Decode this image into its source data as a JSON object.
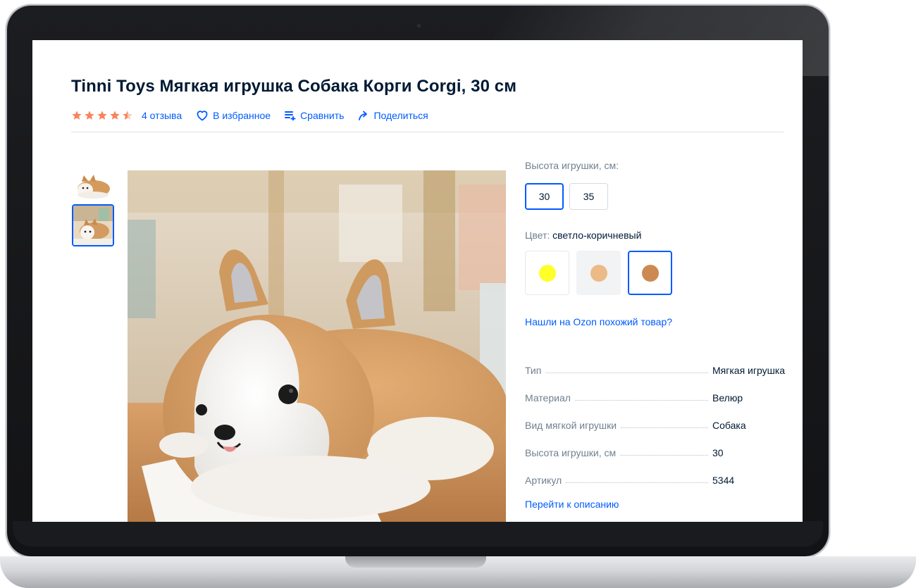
{
  "product": {
    "title": "Tinni Toys Мягкая игрушка Собака Корги Corgi, 30 см",
    "rating": 4.5,
    "reviews_label": "4 отзыва",
    "favorite_label": "В избранное",
    "compare_label": "Сравнить",
    "share_label": "Поделиться"
  },
  "gallery": {
    "thumbnails": [
      "corgi-side",
      "corgi-room"
    ],
    "selected_index": 1
  },
  "options": {
    "size_label": "Высота игрушки, см:",
    "sizes": [
      "30",
      "35"
    ],
    "selected_size": "30",
    "color_label": "Цвет:",
    "color_value": "светло-коричневый",
    "colors": [
      "#ffff2a",
      "#ecba86",
      "#cc8a52"
    ],
    "selected_color_index": 2
  },
  "similar_link": "Нашли на Ozon похожий товар?",
  "specs": [
    {
      "key": "Тип",
      "value": "Мягкая игрушка"
    },
    {
      "key": "Материал",
      "value": "Велюр"
    },
    {
      "key": "Вид мягкой игрушки",
      "value": "Собака"
    },
    {
      "key": "Высота игрушки, см",
      "value": "30"
    },
    {
      "key": "Артикул",
      "value": "5344"
    }
  ],
  "description_link": "Перейти к описанию",
  "colors": {
    "accent": "#005bff",
    "title": "#001a34",
    "muted": "#70808f",
    "star": "#f8845c"
  }
}
